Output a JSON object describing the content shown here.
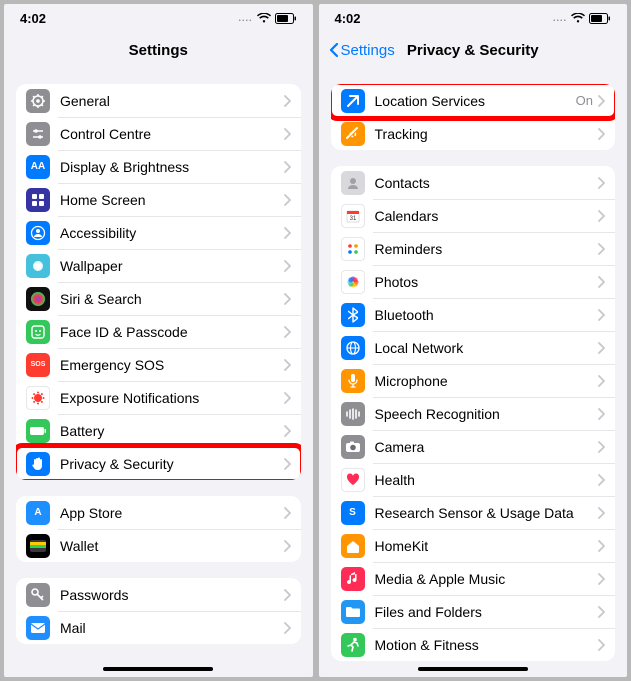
{
  "status": {
    "time": "4:02",
    "dots": "....",
    "wifi": "wifi",
    "battery": "battery"
  },
  "left": {
    "title": "Settings",
    "groups": [
      {
        "rows": [
          {
            "id": "general",
            "label": "General",
            "icon": "gear",
            "bg": "#8e8e93"
          },
          {
            "id": "control-centre",
            "label": "Control Centre",
            "icon": "sliders",
            "bg": "#8e8e93"
          },
          {
            "id": "display",
            "label": "Display & Brightness",
            "icon": "AA",
            "bg": "#007aff",
            "textIcon": true
          },
          {
            "id": "homescreen",
            "label": "Home Screen",
            "icon": "grid",
            "bg": "#3634a3"
          },
          {
            "id": "accessibility",
            "label": "Accessibility",
            "icon": "person",
            "bg": "#007aff"
          },
          {
            "id": "wallpaper",
            "label": "Wallpaper",
            "icon": "flower",
            "bg": "#45c1de"
          },
          {
            "id": "siri",
            "label": "Siri & Search",
            "icon": "siri",
            "bg": "#101010"
          },
          {
            "id": "faceid",
            "label": "Face ID & Passcode",
            "icon": "face",
            "bg": "#34c759"
          },
          {
            "id": "sos",
            "label": "Emergency SOS",
            "icon": "SOS",
            "bg": "#ff3b30",
            "textIcon": true
          },
          {
            "id": "exposure",
            "label": "Exposure Notifications",
            "icon": "virus",
            "bg": "#ffffff",
            "fg": "#ff3b30",
            "border": true
          },
          {
            "id": "battery",
            "label": "Battery",
            "icon": "battery",
            "bg": "#34c759"
          },
          {
            "id": "privacy",
            "label": "Privacy & Security",
            "icon": "hand",
            "bg": "#007aff",
            "highlight": true
          }
        ]
      },
      {
        "rows": [
          {
            "id": "appstore",
            "label": "App Store",
            "icon": "A",
            "bg": "#1e8fff",
            "textIcon": true
          },
          {
            "id": "wallet",
            "label": "Wallet",
            "icon": "wallet",
            "bg": "#000000"
          }
        ]
      },
      {
        "rows": [
          {
            "id": "passwords",
            "label": "Passwords",
            "icon": "key",
            "bg": "#8e8e93"
          },
          {
            "id": "mail",
            "label": "Mail",
            "icon": "mail",
            "bg": "#1f8fff"
          }
        ]
      }
    ]
  },
  "right": {
    "back": "Settings",
    "title": "Privacy & Security",
    "groups": [
      {
        "rows": [
          {
            "id": "location",
            "label": "Location Services",
            "value": "On",
            "icon": "arrow",
            "bg": "#007aff",
            "highlight": true
          },
          {
            "id": "tracking",
            "label": "Tracking",
            "icon": "track",
            "bg": "#ff9500"
          }
        ]
      },
      {
        "rows": [
          {
            "id": "contacts",
            "label": "Contacts",
            "icon": "contact",
            "bg": "#d8d8dd"
          },
          {
            "id": "calendars",
            "label": "Calendars",
            "icon": "cal",
            "bg": "#ffffff",
            "fg": "#ff3b30",
            "border": true
          },
          {
            "id": "reminders",
            "label": "Reminders",
            "icon": "dots",
            "bg": "#ffffff",
            "border": true
          },
          {
            "id": "photos",
            "label": "Photos",
            "icon": "photos",
            "bg": "#ffffff",
            "border": true
          },
          {
            "id": "bluetooth",
            "label": "Bluetooth",
            "icon": "bt",
            "bg": "#007aff"
          },
          {
            "id": "localnet",
            "label": "Local Network",
            "icon": "globe",
            "bg": "#007aff"
          },
          {
            "id": "mic",
            "label": "Microphone",
            "icon": "mic",
            "bg": "#ff9500"
          },
          {
            "id": "speech",
            "label": "Speech Recognition",
            "icon": "wave",
            "bg": "#8e8e93"
          },
          {
            "id": "camera",
            "label": "Camera",
            "icon": "cam",
            "bg": "#8e8e93"
          },
          {
            "id": "health",
            "label": "Health",
            "icon": "heart",
            "bg": "#ffffff",
            "fg": "#ff2d55",
            "border": true
          },
          {
            "id": "research",
            "label": "Research Sensor & Usage Data",
            "icon": "S",
            "bg": "#007aff",
            "textIcon": true
          },
          {
            "id": "homekit",
            "label": "HomeKit",
            "icon": "home",
            "bg": "#ff9500"
          },
          {
            "id": "media",
            "label": "Media & Apple Music",
            "icon": "music",
            "bg": "#ff2d55"
          },
          {
            "id": "files",
            "label": "Files and Folders",
            "icon": "folder",
            "bg": "#2196f3"
          },
          {
            "id": "motion",
            "label": "Motion & Fitness",
            "icon": "run",
            "bg": "#34c759"
          }
        ]
      }
    ]
  }
}
